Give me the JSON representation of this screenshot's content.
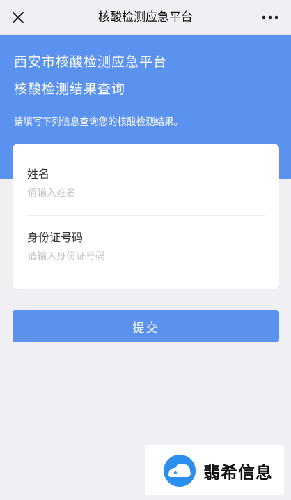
{
  "nav": {
    "title": "核酸检测应急平台",
    "close_icon": "close-icon",
    "more_icon": "more-dots-icon"
  },
  "hero": {
    "line1": "西安市核酸检测应急平台",
    "line2": "核酸检测结果查询",
    "hint": "请填写下列信息查询您的核酸检测结果。"
  },
  "form": {
    "name_label": "姓名",
    "name_value": "",
    "name_placeholder": "请输入姓名",
    "id_label": "身份证号码",
    "id_value": "",
    "id_placeholder": "请输入身份证号码"
  },
  "submit_label": "提交",
  "watermark": {
    "text": "翡希信息"
  },
  "colors": {
    "accent": "#5b92f0",
    "background": "#efeff4",
    "card": "#ffffff",
    "placeholder": "#c4c4c4"
  }
}
